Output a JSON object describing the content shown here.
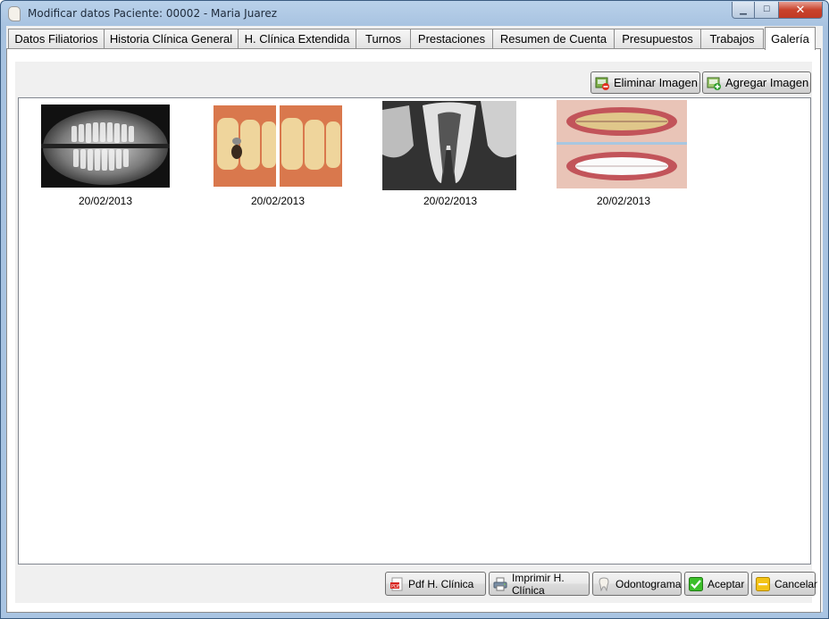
{
  "window": {
    "title": "Modificar datos Paciente: 00002 - Maria Juarez",
    "minimize_glyph": "▁",
    "maximize_glyph": "☐",
    "close_glyph": "✕"
  },
  "tabs": [
    {
      "label": "Datos Filiatorios"
    },
    {
      "label": "Historia Clínica General"
    },
    {
      "label": "H. Clínica Extendida"
    },
    {
      "label": "Turnos"
    },
    {
      "label": "Prestaciones"
    },
    {
      "label": "Resumen de Cuenta"
    },
    {
      "label": "Presupuestos"
    },
    {
      "label": "Trabajos"
    },
    {
      "label": "Galería"
    }
  ],
  "active_tab": "Galería",
  "gallery": {
    "delete_label": "Eliminar Imagen",
    "add_label": "Agregar Imagen",
    "images": [
      {
        "date": "20/02/2013",
        "kind": "panoramic-xray"
      },
      {
        "date": "20/02/2013",
        "kind": "molar-filling-before-after"
      },
      {
        "date": "20/02/2013",
        "kind": "periapical-xray"
      },
      {
        "date": "20/02/2013",
        "kind": "smile-whitening-before-after"
      }
    ]
  },
  "footer": {
    "pdf_label": "Pdf H. Clínica",
    "print_label": "Imprimir H. Clínica",
    "odontogram_label": "Odontograma",
    "accept_label": "Aceptar",
    "cancel_label": "Cancelar"
  },
  "colors": {
    "title_bar": "#b9d1ea",
    "close_button": "#c8432c",
    "accept_icon": "#3cbf2a",
    "cancel_icon": "#f3c316",
    "pdf_icon": "#d8241e"
  }
}
